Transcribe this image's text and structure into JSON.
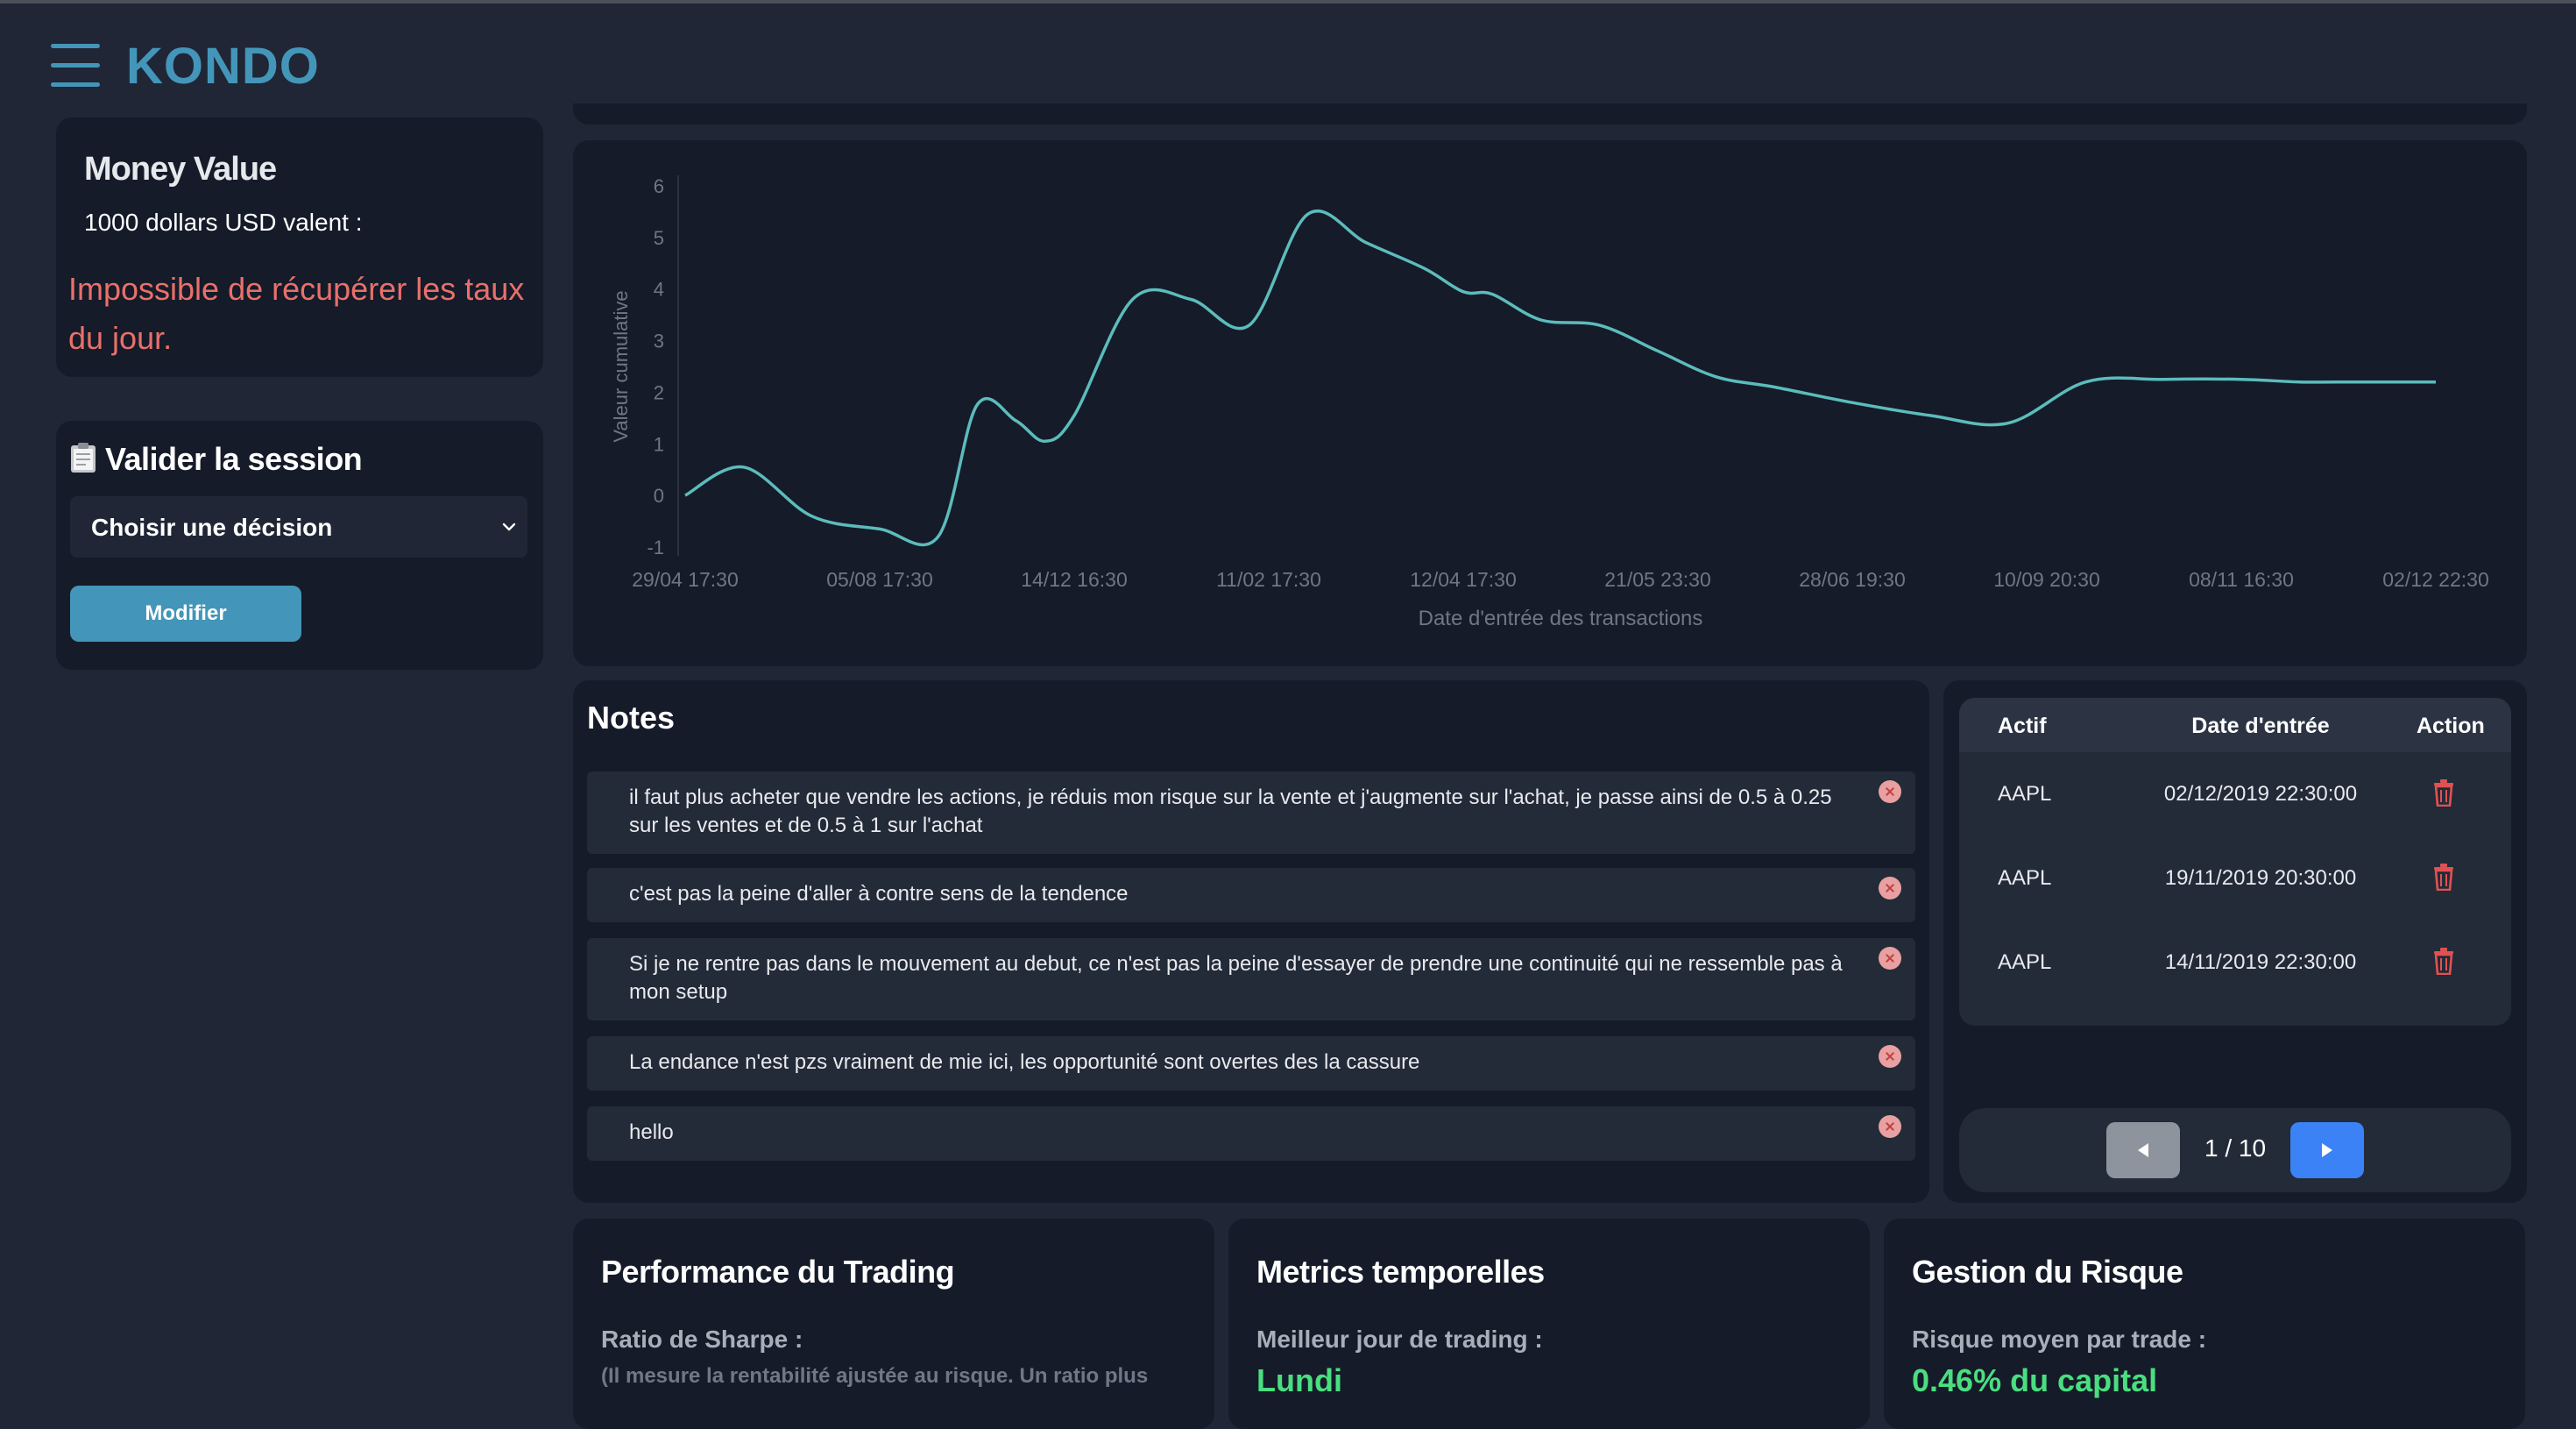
{
  "app": {
    "brand": "KONDO"
  },
  "money": {
    "title": "Money Value",
    "subtitle": "1000 dollars USD valent :",
    "error": "Impossible de récupérer les taux du jour."
  },
  "session": {
    "title": "Valider la session",
    "select_value": "Choisir une décision",
    "modify_button": "Modifier"
  },
  "chart_data": {
    "type": "line",
    "title": "",
    "xlabel": "Date d'entrée des transactions",
    "ylabel": "Valeur cumulative",
    "ylim": [
      -1,
      6
    ],
    "y_ticks": [
      -1,
      0,
      1,
      2,
      3,
      4,
      5,
      6
    ],
    "x_tick_labels": [
      "29/04 17:30",
      "05/08 17:30",
      "14/12 16:30",
      "11/02 17:30",
      "12/04 17:30",
      "21/05 23:30",
      "28/06 19:30",
      "10/09 20:30",
      "08/11 16:30",
      "02/12 22:30"
    ],
    "x": [
      0,
      0.3,
      0.65,
      1,
      1.3,
      1.5,
      1.7,
      1.85,
      2,
      2.3,
      2.6,
      2.9,
      3.2,
      3.5,
      3.8,
      4,
      4.15,
      4.4,
      4.7,
      5,
      5.3,
      5.6,
      6,
      6.4,
      6.8,
      7.2,
      7.6,
      8,
      8.3,
      8.6,
      8.75,
      9
    ],
    "values": [
      0,
      0.55,
      -0.4,
      -0.65,
      -0.8,
      1.75,
      1.45,
      1.05,
      1.55,
      3.8,
      3.8,
      3.3,
      5.45,
      4.9,
      4.4,
      3.95,
      3.9,
      3.4,
      3.3,
      2.8,
      2.3,
      2.1,
      1.8,
      1.55,
      1.4,
      2.2,
      2.25,
      2.25,
      2.2,
      2.2,
      2.2,
      2.2
    ],
    "grid": false,
    "line_color": "#5cbcbc"
  },
  "notes": {
    "title": "Notes",
    "items": [
      {
        "text": "il faut plus acheter que vendre les actions, je réduis mon risque sur la vente et j'augmente sur l'achat, je passe ainsi de 0.5 à 0.25 sur les ventes et de 0.5 à 1 sur l'achat"
      },
      {
        "text": "c'est pas la peine d'aller à contre sens de la tendence"
      },
      {
        "text": "Si je ne rentre pas dans le mouvement au debut, ce n'est pas la peine d'essayer de prendre une continuité qui ne ressemble pas à mon setup"
      },
      {
        "text": "La endance n'est pzs vraiment de mie ici, les opportunité sont overtes des la cassure"
      },
      {
        "text": "hello"
      }
    ]
  },
  "transactions": {
    "headers": {
      "asset": "Actif",
      "date": "Date d'entrée",
      "action": "Action"
    },
    "rows": [
      {
        "asset": "AAPL",
        "date": "02/12/2019 22:30:00"
      },
      {
        "asset": "AAPL",
        "date": "19/11/2019 20:30:00"
      },
      {
        "asset": "AAPL",
        "date": "14/11/2019 22:30:00"
      }
    ],
    "pager": {
      "label": "1 / 10"
    }
  },
  "stats": {
    "performance": {
      "title": "Performance du Trading",
      "label": "Ratio de Sharpe :",
      "desc": "(Il mesure la rentabilité ajustée au risque. Un ratio plus"
    },
    "time": {
      "title": "Metrics temporelles",
      "label": "Meilleur jour de trading :",
      "value": "Lundi"
    },
    "risk": {
      "title": "Gestion du Risque",
      "label": "Risque moyen par trade :",
      "value": "0.46% du capital"
    }
  },
  "colors": {
    "brand": "#4396b9",
    "error": "#e9706a",
    "positive": "#4ade80",
    "delete": "#e05252",
    "pager_next": "#3b82f6"
  }
}
